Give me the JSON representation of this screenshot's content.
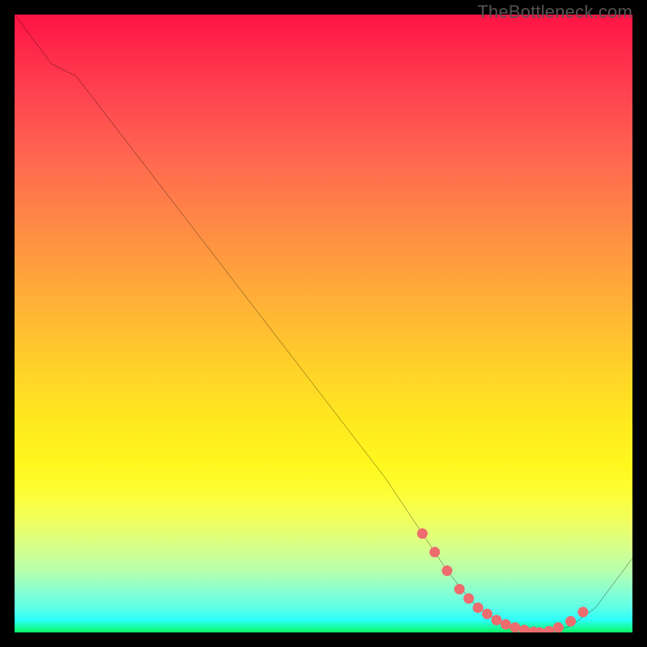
{
  "watermark": "TheBottleneck.com",
  "chart_data": {
    "type": "line",
    "title": "",
    "xlabel": "",
    "ylabel": "",
    "xlim": [
      0,
      100
    ],
    "ylim": [
      0,
      100
    ],
    "series": [
      {
        "name": "bottleneck-curve",
        "x": [
          0,
          6,
          10,
          20,
          30,
          40,
          50,
          60,
          66,
          70,
          74,
          78,
          82,
          86,
          90,
          94,
          100
        ],
        "y": [
          100,
          92,
          90,
          77,
          64,
          51,
          38,
          25,
          16,
          10,
          5,
          2,
          0.5,
          0,
          1,
          4,
          12
        ]
      }
    ],
    "markers": {
      "name": "highlight-dots",
      "color": "#ee6b6e",
      "x": [
        66,
        68,
        70,
        72,
        73.5,
        75,
        76.5,
        78,
        79.5,
        81,
        82.5,
        84,
        85,
        86.5,
        88,
        90,
        92
      ],
      "y": [
        16,
        13,
        10,
        7,
        5.5,
        4,
        3,
        2,
        1.3,
        0.8,
        0.4,
        0.1,
        0,
        0.2,
        0.8,
        1.8,
        3.3
      ]
    }
  }
}
